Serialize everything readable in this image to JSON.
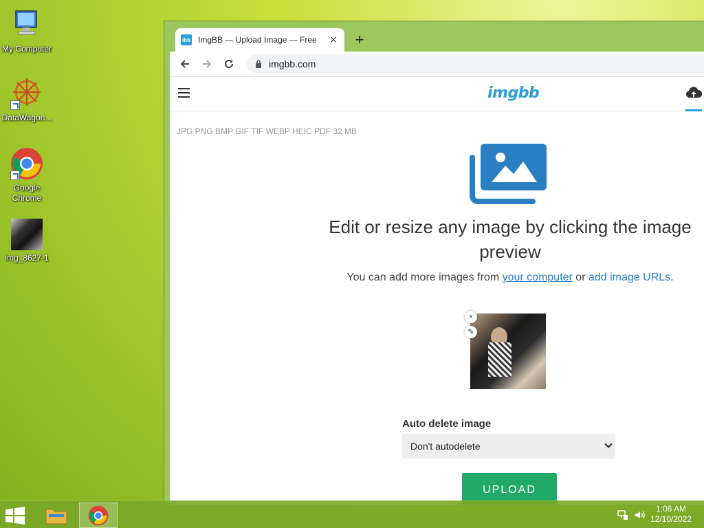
{
  "desktop": {
    "icons": [
      {
        "label": "My Computer"
      },
      {
        "label": "DataWagon..."
      },
      {
        "label": "Google Chrome"
      },
      {
        "label": "img_8627-1"
      }
    ]
  },
  "browser": {
    "tab_title": "ImgBB — Upload Image — Free",
    "tab_favicon": "ibb",
    "new_tab_label": "+",
    "address": "imgbb.com"
  },
  "site": {
    "logo": "imgbb",
    "formats": "JPG PNG BMP GIF TIF WEBP HEIC PDF   32 MB",
    "headline": "Edit or resize any image by clicking the image preview",
    "sub_prefix": "You can add more images from ",
    "sub_link1": "your computer",
    "sub_mid": " or ",
    "sub_link2": "add image URLs",
    "sub_suffix": ".",
    "auto_delete_label": "Auto delete image",
    "auto_delete_value": "Don't autodelete",
    "upload_label": "UPLOAD",
    "remove_label": "×",
    "edit_label": "✎"
  },
  "taskbar": {
    "time": "1:06 AM",
    "date": "12/10/2022"
  },
  "colors": {
    "accent": "#2a9fd6",
    "upload_green": "#23a967",
    "link": "#2a7fc4"
  }
}
